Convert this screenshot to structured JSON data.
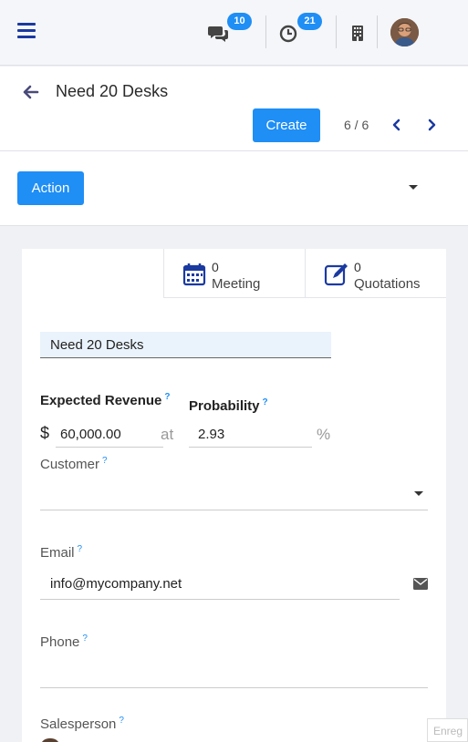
{
  "navbar": {
    "messages_badge": "10",
    "activities_badge": "21"
  },
  "record": {
    "title": "Need 20 Desks",
    "create_label": "Create",
    "pager": "6 / 6",
    "action_label": "Action"
  },
  "stats": {
    "meeting_count": "0",
    "meeting_label": "Meeting",
    "quotation_count": "0",
    "quotation_label": "Quotations"
  },
  "form": {
    "name": "Need 20 Desks",
    "expected_revenue_label": "Expected Revenue",
    "currency_symbol": "$",
    "expected_revenue": "60,000.00",
    "at_label": "at",
    "probability_label": "Probability",
    "probability": "2.93",
    "percent_symbol": "%",
    "customer_label": "Customer",
    "customer": "",
    "email_label": "Email",
    "email": "info@mycompany.net",
    "phone_label": "Phone",
    "phone": "",
    "salesperson_label": "Salesperson",
    "help_mark": "?"
  },
  "corner_tab": "Enreg",
  "colors": {
    "primary": "#1f8ef5",
    "nav_icon": "#1b3aa0"
  }
}
